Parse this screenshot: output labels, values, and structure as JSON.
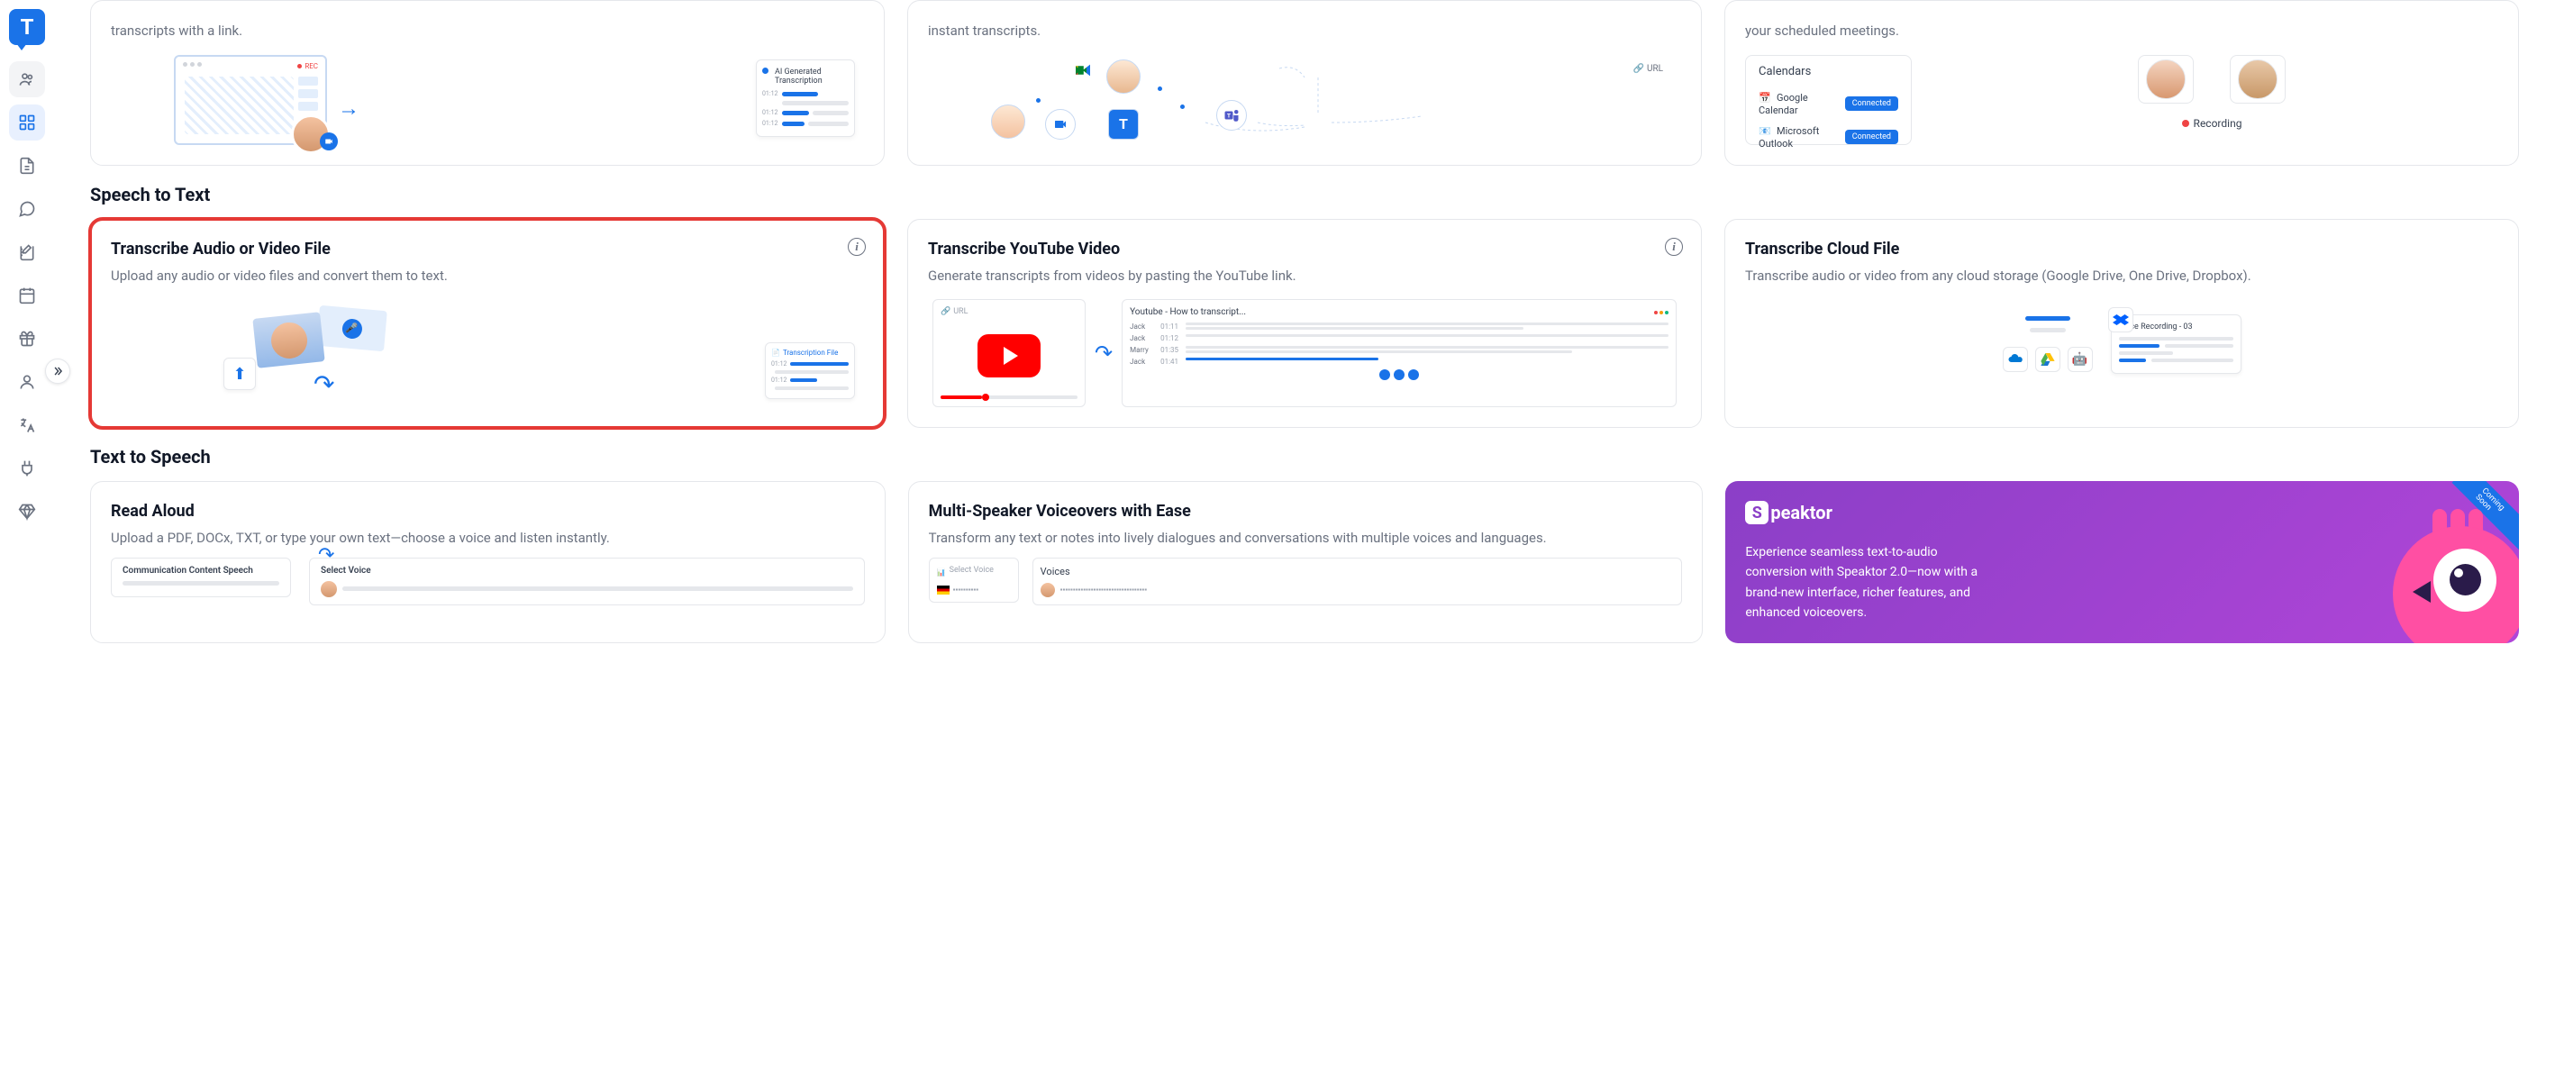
{
  "top_row": [
    {
      "desc_fragment": "transcripts with a link.",
      "rec_label": "REC",
      "panel_title": "AI Generated Transcription",
      "times": [
        "01:12",
        "01:12",
        "01:12"
      ]
    },
    {
      "desc_fragment": "instant transcripts.",
      "url_label": "URL"
    },
    {
      "desc_fragment": "your scheduled meetings.",
      "calendars_title": "Calendars",
      "google": "Google Calendar",
      "outlook": "Microsoft Outlook",
      "connected": "Connected",
      "recording": "Recording"
    }
  ],
  "sections": {
    "speech_to_text": "Speech to Text",
    "text_to_speech": "Text to Speech"
  },
  "speech_cards": [
    {
      "title": "Transcribe Audio or Video File",
      "desc": "Upload any audio or video files and convert them to text.",
      "panel_title": "Transcription File",
      "times": [
        "01:12",
        "01:12"
      ]
    },
    {
      "title": "Transcribe YouTube Video",
      "desc": "Generate transcripts from videos by pasting the YouTube link.",
      "url": "URL",
      "video_title": "Youtube - How to transcript...",
      "rows": [
        {
          "name": "Jack",
          "time": "01:11"
        },
        {
          "name": "Jack",
          "time": "01:12"
        },
        {
          "name": "Marry",
          "time": "01:35"
        },
        {
          "name": "Jack",
          "time": "01:41"
        }
      ]
    },
    {
      "title": "Transcribe Cloud File",
      "desc": "Transcribe audio or video from any cloud storage (Google Drive, One Drive, Dropbox).",
      "panel_title": "Voice Recording - 03"
    }
  ],
  "tts_cards": [
    {
      "title": "Read Aloud",
      "desc": "Upload a PDF, DOCx, TXT, or type your own text—choose a voice and listen instantly.",
      "panel1": "Communication Content Speech",
      "panel2": "Select Voice"
    },
    {
      "title": "Multi-Speaker Voiceovers with Ease",
      "desc": "Transform any text or notes into lively dialogues and conversations with multiple voices and languages.",
      "select_title": "Select Voice",
      "voices_title": "Voices"
    }
  ],
  "promo": {
    "brand": "peaktor",
    "text": "Experience seamless text-to-audio conversion with Speaktor 2.0—now with a brand-new interface, richer features, and enhanced voiceovers.",
    "badge": "Coming Soon"
  }
}
